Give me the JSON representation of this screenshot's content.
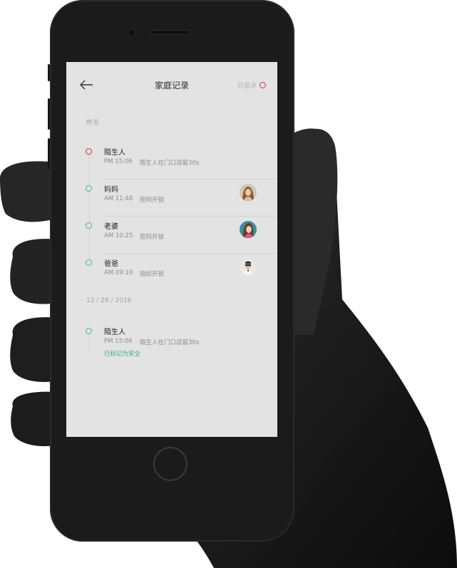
{
  "header": {
    "title": "家庭记录",
    "filter_label": "只显示"
  },
  "sections": [
    {
      "date": "昨天",
      "entries": [
        {
          "name": "陌生人",
          "time": "PM 15:06",
          "desc": "陌生人在门口逗留30s",
          "status": "alert",
          "avatar": ""
        },
        {
          "name": "妈妈",
          "time": "AM 11:48",
          "desc": "密码开锁",
          "status": "ok",
          "avatar": "avatar-mom"
        },
        {
          "name": "老婆",
          "time": "AM 10:25",
          "desc": "密码开锁",
          "status": "ok",
          "avatar": "avatar-wife"
        },
        {
          "name": "爸爸",
          "time": "AM 09:10",
          "desc": "指纹开锁",
          "status": "ok",
          "avatar": "avatar-dad"
        }
      ]
    },
    {
      "date": "12 / 28 / 2016",
      "entries": [
        {
          "name": "陌生人",
          "time": "PM 15:06",
          "desc": "陌生人在门口逗留30s",
          "status": "ok",
          "note": "已标记为安全"
        }
      ]
    }
  ],
  "colors": {
    "alert": "#cc2e3d",
    "ok": "#3fb59a",
    "safe_text": "#33b08d",
    "screen_bg": "#e3e3e3"
  }
}
